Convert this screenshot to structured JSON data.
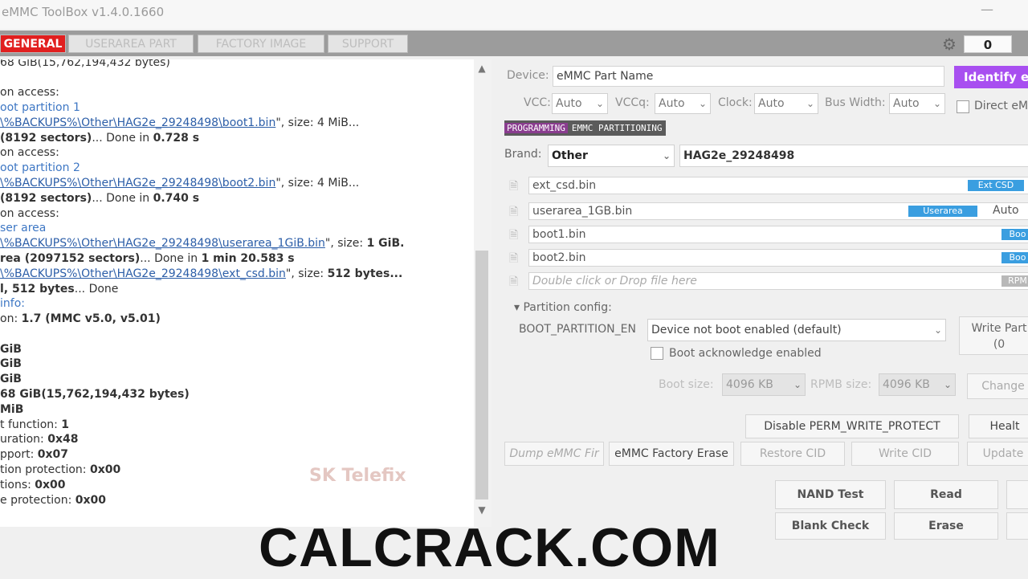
{
  "window": {
    "title": "eMMC ToolBox v1.4.0.1660",
    "minimize_glyph": "—",
    "counter": "0",
    "globe_icon": "globe-icon"
  },
  "tabs": [
    "GENERAL",
    "USERAREA PART",
    "FACTORY IMAGE",
    "SUPPORT"
  ],
  "log": {
    "l0": "68 GiB(15,762,194,432 bytes)",
    "l1": "on access:",
    "l2": "oot partition 1",
    "l3a": "\\%BACKUPS%\\Other\\HAG2e_29248498\\boot1.bin",
    "l3b": "\", size: 4 MiB...",
    "l4a": "(8192 sectors)",
    "l4b": "... Done in ",
    "l4c": "0.728 s",
    "l5": "on access:",
    "l6": "oot partition 2",
    "l7a": "\\%BACKUPS%\\Other\\HAG2e_29248498\\boot2.bin",
    "l7b": "\", size: 4 MiB...",
    "l8a": "(8192 sectors)",
    "l8b": "... Done in ",
    "l8c": "0.740 s",
    "l9": "on access:",
    "l10": "ser area",
    "l11a": "\\%BACKUPS%\\Other\\HAG2e_29248498\\userarea_1GiB.bin",
    "l11b": "\", size: ",
    "l11c": "1 GiB.",
    "l12a": "rea (2097152 sectors)",
    "l12b": "... Done in ",
    "l12c": "1 min 20.583 s",
    "l13a": "\\%BACKUPS%\\Other\\HAG2e_29248498\\ext_csd.bin",
    "l13b": "\", size: ",
    "l13c": "512 bytes...",
    "l14a": "l, 512 bytes",
    "l14b": "... Done",
    "l15": " info:",
    "l16a": "on: ",
    "l16b": "1.7 (MMC v5.0, v5.01)",
    "l17": "GiB",
    "l18": "GiB",
    "l19": "GiB",
    "l20": "68 GiB(15,762,194,432 bytes)",
    "l21": "MiB",
    "l22a": "t function: ",
    "l22b": "1",
    "l23a": "uration: ",
    "l23b": "0x48",
    "l24a": "pport: ",
    "l24b": "0x07",
    "l25a": "tion protection: ",
    "l25b": "0x00",
    "l26a": "tions: ",
    "l26b": "0x00",
    "l27a": "e protection: ",
    "l27b": "0x00"
  },
  "device": {
    "label": "Device:",
    "value": "eMMC Part Name",
    "identify": "Identify e",
    "vcc_label": "VCC:",
    "vcc": "Auto",
    "vccq_label": "VCCq:",
    "vccq": "Auto",
    "clock_label": "Clock:",
    "clock": "Auto",
    "bus_label": "Bus Width:",
    "bus": "Auto",
    "direct": "Direct eM"
  },
  "subtabs": {
    "prog": "PROGRAMMING",
    "part": "EMMC PARTITIONING"
  },
  "brand": {
    "label": "Brand:",
    "value": "Other",
    "part": "HAG2e_29248498"
  },
  "files": [
    {
      "name": "ext_csd.bin",
      "badge": "Ext CSD"
    },
    {
      "name": "userarea_1GB.bin",
      "badge": "Userarea",
      "mode": "Auto"
    },
    {
      "name": "boot1.bin",
      "badge": "Boo"
    },
    {
      "name": "boot2.bin",
      "badge": "Boo"
    },
    {
      "name": "Double click or Drop file here",
      "badge": "RPM"
    }
  ],
  "partition": {
    "header": "Partition config:",
    "boot_label": "BOOT_PARTITION_EN",
    "boot_value": "Device not boot enabled (default)",
    "ack": "Boot acknowledge enabled",
    "write_btn": "Write Part",
    "write_btn2": "(0",
    "boot_size_label": "Boot size:",
    "boot_size": "4096 KB",
    "rpmb_label": "RPMB size:",
    "rpmb_size": "4096 KB",
    "change": "Change"
  },
  "buttons": {
    "disable": "Disable PERM_WRITE_PROTECT",
    "health": "Healt",
    "dump": "Dump eMMC Fir",
    "factory_erase": "eMMC Factory Erase",
    "restore_cid": "Restore CID",
    "write_cid": "Write CID",
    "update": "Update",
    "nand_test": "NAND Test",
    "read": "Read",
    "blank_check": "Blank Check",
    "erase": "Erase"
  },
  "watermark": "SK Telefix",
  "banner": "CALCRACK.COM"
}
